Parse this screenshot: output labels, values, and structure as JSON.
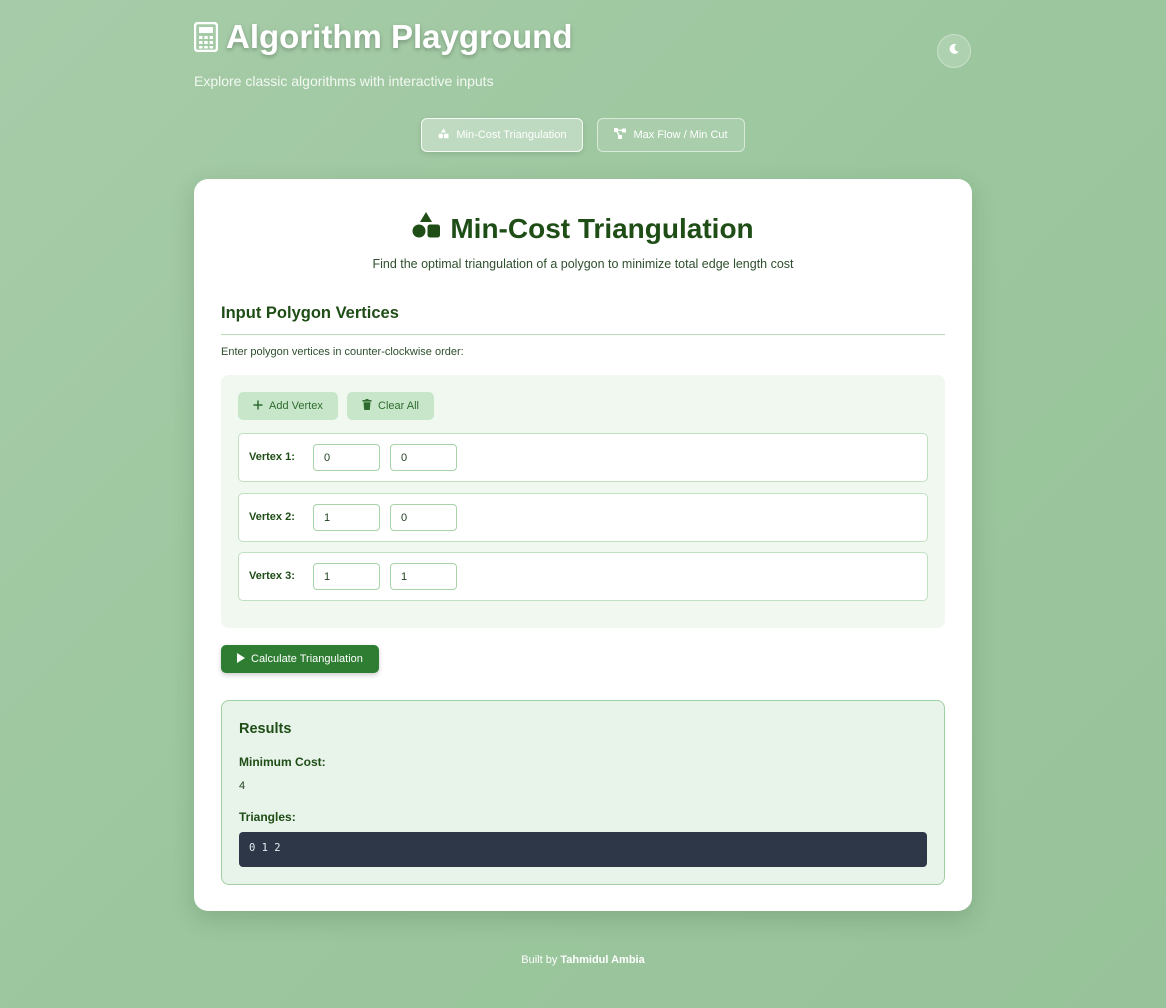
{
  "header": {
    "title": "Algorithm Playground",
    "subtitle": "Explore classic algorithms with interactive inputs",
    "title_icon": "calculator-icon",
    "theme_toggle_icon": "moon-icon"
  },
  "tabs": [
    {
      "label": "Min-Cost Triangulation",
      "icon": "shapes-icon",
      "active": true
    },
    {
      "label": "Max Flow / Min Cut",
      "icon": "network-icon",
      "active": false
    }
  ],
  "card": {
    "title": "Min-Cost Triangulation",
    "title_icon": "shapes-icon",
    "description": "Find the optimal triangulation of a polygon to minimize total edge length cost",
    "section_heading": "Input Polygon Vertices",
    "instructions": "Enter polygon vertices in counter-clockwise order:",
    "add_vertex_label": "Add Vertex",
    "clear_all_label": "Clear All",
    "vertices": [
      {
        "label": "Vertex 1:",
        "x": "0",
        "y": "0"
      },
      {
        "label": "Vertex 2:",
        "x": "1",
        "y": "0"
      },
      {
        "label": "Vertex 3:",
        "x": "1",
        "y": "1"
      }
    ],
    "calculate_label": "Calculate Triangulation"
  },
  "results": {
    "title": "Results",
    "min_cost_label": "Minimum Cost:",
    "min_cost_value": "4",
    "triangles_label": "Triangles:",
    "triangles_value": "0 1 2"
  },
  "footer": {
    "prefix": "Built by",
    "author": "Tahmidul Ambia"
  },
  "colors": {
    "accent": "#2e7d32",
    "heading": "#1e4d16",
    "code_bg": "#2d3748"
  }
}
